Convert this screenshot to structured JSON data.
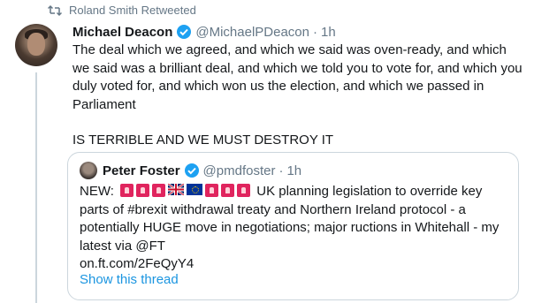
{
  "retweet": {
    "label": "Roland Smith Retweeted",
    "icon": "retweet-icon"
  },
  "tweet": {
    "author_name": "Michael Deacon",
    "handle": "@MichaelPDeacon",
    "separator": "·",
    "time": "1h",
    "text_p1": "The deal which we agreed, and which we said was oven-ready, and which we said was a brilliant deal, and which we told you to vote for, and which you duly voted for, and which won us the election, and which we passed in Parliament",
    "text_p2": "IS TERRIBLE AND WE MUST DESTROY IT"
  },
  "quote": {
    "author_name": "Peter Foster",
    "handle": "@pmdfoster",
    "separator": "·",
    "time": "1h",
    "text_prefix": "NEW:",
    "text_body": "UK planning legislation to override key parts of #brexit withdrawal treaty and Northern Ireland protocol - a potentially HUGE move in negotiations; major ructions in Whitehall - my latest via @FT",
    "link": "on.ft.com/2FeQyY4",
    "show_thread": "Show this thread"
  },
  "colors": {
    "accent": "#1b95e0",
    "verified": "#1da1f2",
    "muted": "#657786",
    "siren": "#e0245e"
  }
}
